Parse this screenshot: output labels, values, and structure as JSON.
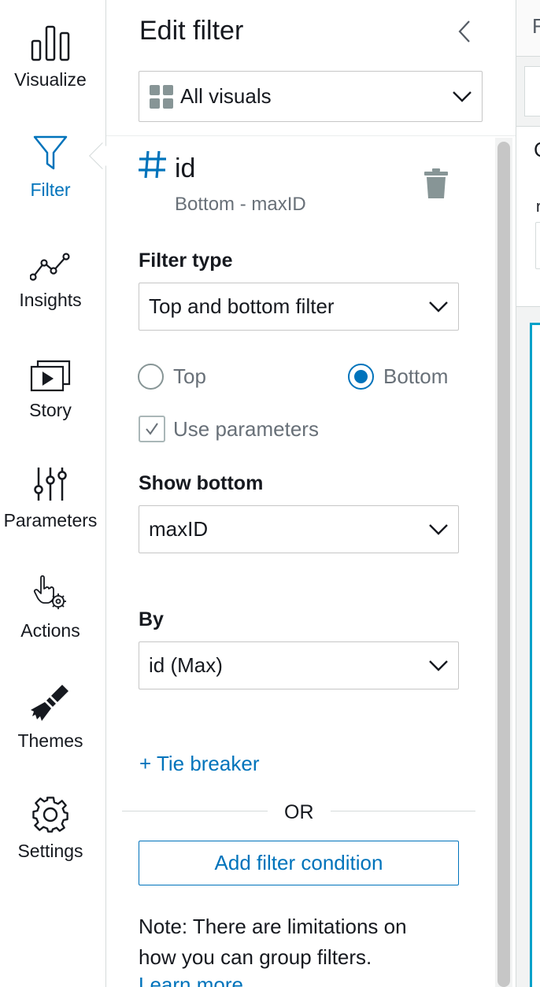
{
  "nav": {
    "items": [
      {
        "label": "Visualize",
        "icon": "bar-chart-icon"
      },
      {
        "label": "Filter",
        "icon": "filter-icon",
        "active": true
      },
      {
        "label": "Insights",
        "icon": "insights-icon"
      },
      {
        "label": "Story",
        "icon": "story-icon"
      },
      {
        "label": "Parameters",
        "icon": "parameters-icon"
      },
      {
        "label": "Actions",
        "icon": "actions-icon"
      },
      {
        "label": "Themes",
        "icon": "themes-brush-icon"
      },
      {
        "label": "Settings",
        "icon": "settings-gear-icon"
      }
    ],
    "active_color": "#0073bb"
  },
  "panel": {
    "title": "Edit filter",
    "scope": "All visuals",
    "field": {
      "name": "id",
      "subtitle": "Bottom - maxID"
    },
    "filter_type": {
      "label": "Filter type",
      "value": "Top and bottom filter"
    },
    "direction": {
      "top_label": "Top",
      "bottom_label": "Bottom",
      "selected": "Bottom"
    },
    "use_parameters": {
      "label": "Use parameters",
      "checked": true
    },
    "show_bottom": {
      "label": "Show bottom",
      "value": "maxID"
    },
    "by": {
      "label": "By",
      "value": "id (Max)"
    },
    "tie_breaker": "+ Tie breaker",
    "or_label": "OR",
    "add_condition": "Add filter condition",
    "note_line1": "Note: There are limitations on",
    "note_line2": "how you can group filters.",
    "learn_more": "Learn more"
  },
  "workspace": {
    "top_letter": "F",
    "card_letter": "C",
    "card_small": "r"
  }
}
